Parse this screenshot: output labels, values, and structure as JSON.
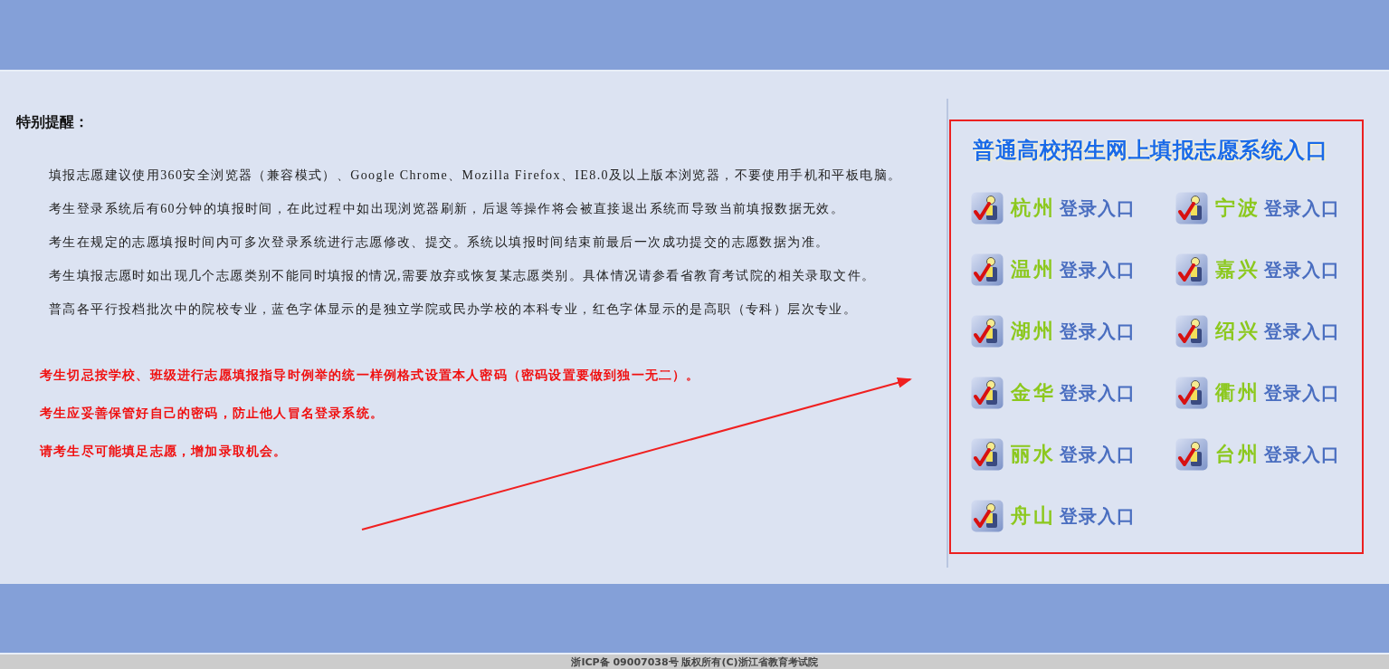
{
  "notice": {
    "heading": "特别提醒：",
    "paragraphs": [
      "填报志愿建议使用360安全浏览器（兼容模式）、Google Chrome、Mozilla Firefox、IE8.0及以上版本浏览器，不要使用手机和平板电脑。",
      "考生登录系统后有60分钟的填报时间，在此过程中如出现浏览器刷新，后退等操作将会被直接退出系统而导致当前填报数据无效。",
      "考生在规定的志愿填报时间内可多次登录系统进行志愿修改、提交。系统以填报时间结束前最后一次成功提交的志愿数据为准。",
      "考生填报志愿时如出现几个志愿类别不能同时填报的情况,需要放弃或恢复某志愿类别。具体情况请参看省教育考试院的相关录取文件。",
      "普高各平行投档批次中的院校专业，蓝色字体显示的是独立学院或民办学校的本科专业，红色字体显示的是高职（专科）层次专业。"
    ],
    "warnings": [
      "考生切忌按学校、班级进行志愿填报指导时例举的统一样例格式设置本人密码（密码设置要做到独一无二）。",
      "考生应妥善保管好自己的密码，防止他人冒名登录系统。",
      "请考生尽可能填足志愿，增加录取机会。"
    ]
  },
  "entry_panel": {
    "title": "普通高校招生网上填报志愿系统入口",
    "entries": [
      {
        "city": "杭州",
        "action": "登录入口"
      },
      {
        "city": "宁波",
        "action": "登录入口"
      },
      {
        "city": "温州",
        "action": "登录入口"
      },
      {
        "city": "嘉兴",
        "action": "登录入口"
      },
      {
        "city": "湖州",
        "action": "登录入口"
      },
      {
        "city": "绍兴",
        "action": "登录入口"
      },
      {
        "city": "金华",
        "action": "登录入口"
      },
      {
        "city": "衢州",
        "action": "登录入口"
      },
      {
        "city": "丽水",
        "action": "登录入口"
      },
      {
        "city": "台州",
        "action": "登录入口"
      },
      {
        "city": "舟山",
        "action": "登录入口"
      }
    ]
  },
  "footer": {
    "text": "浙ICP备 09007038号 版权所有(C)浙江省教育考试院"
  }
}
